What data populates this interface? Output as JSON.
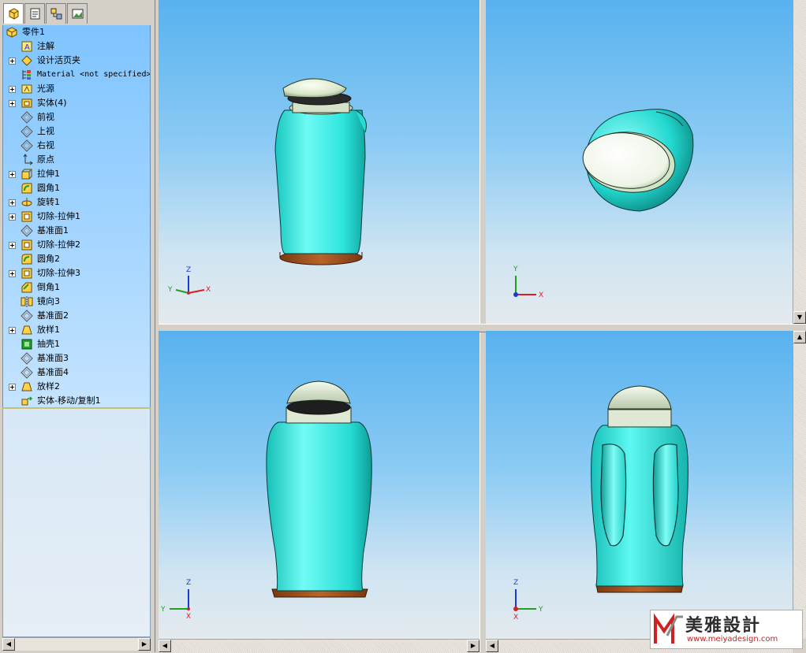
{
  "feature_tree": {
    "tabs": [
      {
        "name": "feature-manager-icon"
      },
      {
        "name": "property-manager-icon"
      },
      {
        "name": "configuration-manager-icon"
      },
      {
        "name": "display-manager-icon"
      }
    ],
    "root": "零件1",
    "items": [
      {
        "label": "注解",
        "icon": "annotation-icon",
        "expand": false
      },
      {
        "label": "设计活页夹",
        "icon": "design-binder-icon",
        "expand": true
      },
      {
        "label": "Material <not specified>",
        "icon": "material-icon",
        "expand": false
      },
      {
        "label": "光源",
        "icon": "lights-icon",
        "expand": true
      },
      {
        "label": "实体(4)",
        "icon": "solid-bodies-icon",
        "expand": true
      },
      {
        "label": "前视",
        "icon": "plane-icon",
        "expand": false
      },
      {
        "label": "上视",
        "icon": "plane-icon",
        "expand": false
      },
      {
        "label": "右视",
        "icon": "plane-icon",
        "expand": false
      },
      {
        "label": "原点",
        "icon": "origin-icon",
        "expand": false
      },
      {
        "label": "拉伸1",
        "icon": "extrude-icon",
        "expand": true
      },
      {
        "label": "圆角1",
        "icon": "fillet-icon",
        "expand": false
      },
      {
        "label": "旋转1",
        "icon": "revolve-icon",
        "expand": true
      },
      {
        "label": "切除-拉伸1",
        "icon": "cut-extrude-icon",
        "expand": true
      },
      {
        "label": "基准面1",
        "icon": "plane-icon",
        "expand": false
      },
      {
        "label": "切除-拉伸2",
        "icon": "cut-extrude-icon",
        "expand": true
      },
      {
        "label": "圆角2",
        "icon": "fillet-icon",
        "expand": false
      },
      {
        "label": "切除-拉伸3",
        "icon": "cut-extrude-icon",
        "expand": true
      },
      {
        "label": "倒角1",
        "icon": "chamfer-icon",
        "expand": false
      },
      {
        "label": "镜向3",
        "icon": "mirror-icon",
        "expand": false
      },
      {
        "label": "基准面2",
        "icon": "plane-icon",
        "expand": false
      },
      {
        "label": "放样1",
        "icon": "loft-icon",
        "expand": true
      },
      {
        "label": "抽壳1",
        "icon": "shell-icon",
        "expand": false
      },
      {
        "label": "基准面3",
        "icon": "plane-icon",
        "expand": false
      },
      {
        "label": "基准面4",
        "icon": "plane-icon",
        "expand": false
      },
      {
        "label": "放样2",
        "icon": "loft-icon",
        "expand": true
      },
      {
        "label": "实体-移动/复制1",
        "icon": "move-copy-body-icon",
        "expand": false
      }
    ]
  },
  "viewports": {
    "isometric": {
      "axes": [
        "Y",
        "Z",
        "X"
      ]
    },
    "top": {
      "axes": [
        "Y",
        "X"
      ]
    },
    "front": {
      "axes": [
        "Y",
        "Z",
        "X"
      ]
    },
    "right": {
      "axes": [
        "Y",
        "Z",
        "X"
      ]
    }
  },
  "colors": {
    "body": "#33e8e0",
    "cap": "#e4ecd8",
    "base": "#a0521a",
    "viewport_top": "#58b2f0",
    "viewport_bottom": "#e4eaee"
  },
  "logo": {
    "text": "美雅設計",
    "url": "www.meiyadesign.com"
  }
}
